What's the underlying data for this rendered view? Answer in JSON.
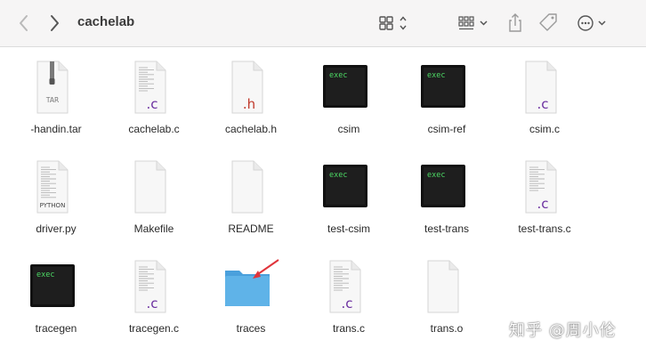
{
  "window": {
    "title": "cachelab"
  },
  "toolbar": {
    "back_icon": "chevron-left-icon",
    "forward_icon": "chevron-right-icon",
    "view_icon": "icon-grid-view-icon",
    "group_icon": "group-by-icon",
    "share_icon": "share-icon",
    "tag_icon": "tag-icon",
    "more_icon": "more-actions-icon"
  },
  "files": [
    {
      "name": "-handin.tar",
      "kind": "archive",
      "badge": "TAR"
    },
    {
      "name": "cachelab.c",
      "kind": "source",
      "badge": ".c"
    },
    {
      "name": "cachelab.h",
      "kind": "header",
      "badge": ".h"
    },
    {
      "name": "csim",
      "kind": "exec",
      "badge": "exec"
    },
    {
      "name": "csim-ref",
      "kind": "exec",
      "badge": "exec"
    },
    {
      "name": "csim.c",
      "kind": "blank-source",
      "badge": ".c"
    },
    {
      "name": "driver.py",
      "kind": "python",
      "badge": "PYTHON"
    },
    {
      "name": "Makefile",
      "kind": "blank",
      "badge": ""
    },
    {
      "name": "README",
      "kind": "blank",
      "badge": ""
    },
    {
      "name": "test-csim",
      "kind": "exec",
      "badge": "exec"
    },
    {
      "name": "test-trans",
      "kind": "exec",
      "badge": "exec"
    },
    {
      "name": "test-trans.c",
      "kind": "source",
      "badge": ".c"
    },
    {
      "name": "tracegen",
      "kind": "exec",
      "badge": "exec"
    },
    {
      "name": "tracegen.c",
      "kind": "source",
      "badge": ".c"
    },
    {
      "name": "traces",
      "kind": "folder",
      "badge": ""
    },
    {
      "name": "trans.c",
      "kind": "source",
      "badge": ".c"
    },
    {
      "name": "trans.o",
      "kind": "blank",
      "badge": ""
    }
  ],
  "watermark": "知乎 @周小伦",
  "colors": {
    "folder": "#5fb3e8",
    "exec_bg": "#1e1e1e",
    "exec_text": "#4cd964",
    "c_badge": "#6b2fa0",
    "h_badge": "#c0392b",
    "arrow": "#e0343b"
  }
}
